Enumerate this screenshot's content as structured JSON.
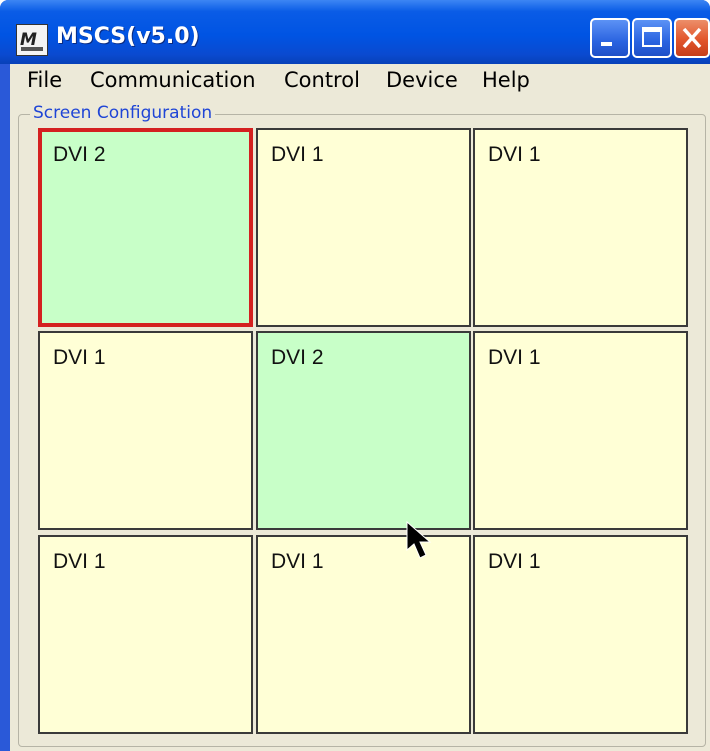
{
  "window": {
    "title": "MSCS(v5.0)",
    "controls": {
      "minimize": "minimize-icon",
      "maximize": "maximize-icon",
      "close": "close-icon"
    }
  },
  "menu": {
    "file": "File",
    "communication": "Communication",
    "control": "Control",
    "device": "Device",
    "help": "Help"
  },
  "group": {
    "label": "Screen Configuration"
  },
  "grid": {
    "rows": 3,
    "cols": 3,
    "cells": [
      {
        "label": "DVI 2",
        "state": "green",
        "selected": true
      },
      {
        "label": "DVI 1",
        "state": "yellow",
        "selected": false
      },
      {
        "label": "DVI 1",
        "state": "yellow",
        "selected": false
      },
      {
        "label": "DVI 1",
        "state": "yellow",
        "selected": false
      },
      {
        "label": "DVI 2",
        "state": "green",
        "selected": false
      },
      {
        "label": "DVI 1",
        "state": "yellow",
        "selected": false
      },
      {
        "label": "DVI 1",
        "state": "yellow",
        "selected": false
      },
      {
        "label": "DVI 1",
        "state": "yellow",
        "selected": false
      },
      {
        "label": "DVI 1",
        "state": "yellow",
        "selected": false
      }
    ]
  },
  "colors": {
    "titlebar": "#0054e3",
    "cell_yellow": "#ffffd6",
    "cell_green": "#c8ffc8",
    "selected_border": "#d42020",
    "group_label": "#1f45d6"
  }
}
